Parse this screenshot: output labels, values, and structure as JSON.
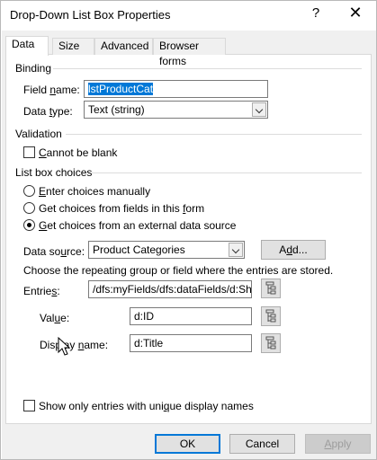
{
  "dialog": {
    "title": "Drop-Down List Box Properties",
    "help_glyph": "?",
    "close_glyph": "✕"
  },
  "tabs": [
    {
      "label": "Data",
      "active": true
    },
    {
      "label": "Size",
      "active": false
    },
    {
      "label": "Advanced",
      "active": false
    },
    {
      "label": "Browser forms",
      "active": false
    }
  ],
  "binding": {
    "section_title": "Binding",
    "field_name_label_pre": "Field ",
    "field_name_label_u": "n",
    "field_name_label_post": "ame:",
    "field_name_value": "lstProductCat",
    "data_type_label_pre": "Data ",
    "data_type_label_u": "t",
    "data_type_label_post": "ype:",
    "data_type_value": "Text (string)"
  },
  "validation": {
    "section_title": "Validation",
    "cannot_be_blank_pre": "",
    "cannot_be_blank_u": "C",
    "cannot_be_blank_post": "annot be blank",
    "cannot_be_blank_checked": false
  },
  "choices": {
    "section_title": "List box choices",
    "option1_u": "E",
    "option1_post": "nter choices manually",
    "option2_pre": "Get choices from fields in this ",
    "option2_u": "f",
    "option2_post": "orm",
    "option3_u": "G",
    "option3_post": "et choices from an external data source",
    "selected": 3,
    "data_source_label_pre": "Data so",
    "data_source_label_u": "u",
    "data_source_label_post": "rce:",
    "data_source_value": "Product Categories",
    "add_button_pre": "A",
    "add_button_u": "d",
    "add_button_post": "d...",
    "instruction": "Choose the repeating group or field where the entries are stored.",
    "entries_label_pre": "Entrie",
    "entries_label_u": "s",
    "entries_label_post": ":",
    "entries_value": "/dfs:myFields/dfs:dataFields/d:Sha",
    "value_label_pre": "Val",
    "value_label_u": "u",
    "value_label_post": "e:",
    "value_value": "d:ID",
    "display_name_label_pre": "Displ",
    "display_name_label_mid": "ay ",
    "display_name_label_u": "n",
    "display_name_label_post": "ame:",
    "display_name_value": "d:Title",
    "unique_pre": "Show only entries with uni",
    "unique_u": "q",
    "unique_post": "ue display names",
    "unique_checked": false
  },
  "footer": {
    "ok_label": "OK",
    "cancel_label": "Cancel",
    "apply_label_pre": "",
    "apply_label_u": "A",
    "apply_label_post": "pply"
  },
  "colors": {
    "accent": "#0078d7",
    "panel_bg": "#f0f0f0"
  }
}
